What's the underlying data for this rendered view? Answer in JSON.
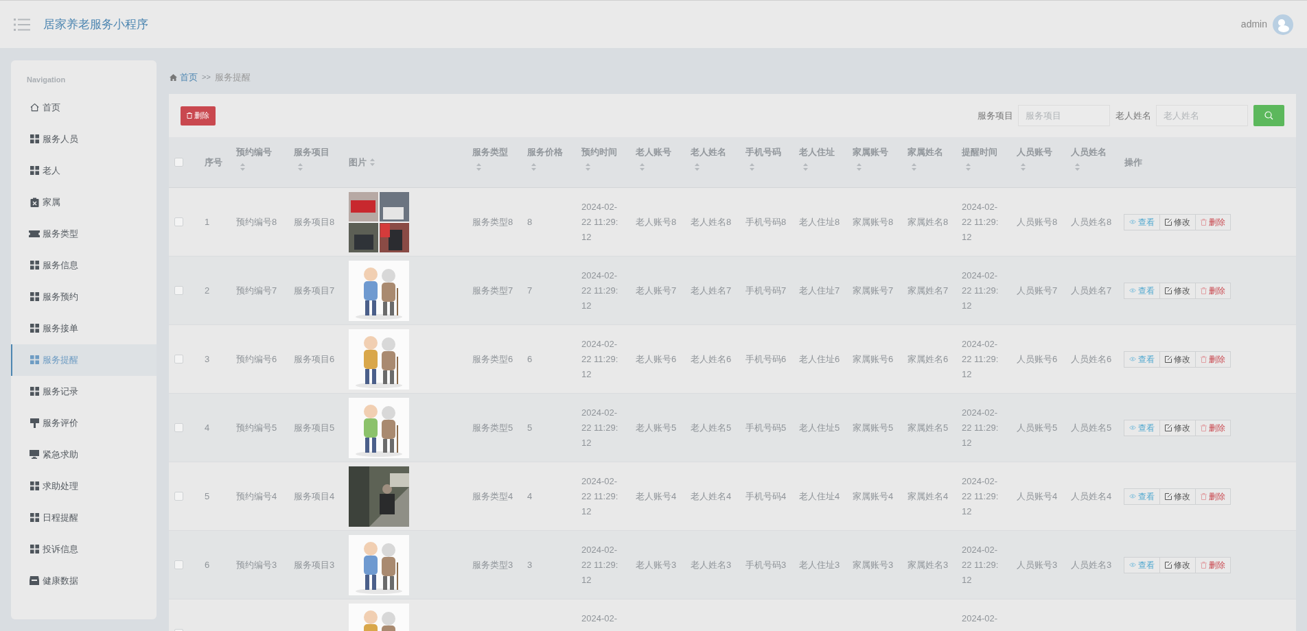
{
  "header": {
    "app_title": "居家养老服务小程序",
    "user": "admin"
  },
  "sidebar": {
    "heading": "Navigation",
    "items": [
      {
        "label": "首页",
        "selected": false
      },
      {
        "label": "服务人员",
        "selected": false
      },
      {
        "label": "老人",
        "selected": false
      },
      {
        "label": "家属",
        "selected": false
      },
      {
        "label": "服务类型",
        "selected": false
      },
      {
        "label": "服务信息",
        "selected": false
      },
      {
        "label": "服务预约",
        "selected": false
      },
      {
        "label": "服务接单",
        "selected": false
      },
      {
        "label": "服务提醒",
        "selected": true
      },
      {
        "label": "服务记录",
        "selected": false
      },
      {
        "label": "服务评价",
        "selected": false
      },
      {
        "label": "紧急求助",
        "selected": false
      },
      {
        "label": "求助处理",
        "selected": false
      },
      {
        "label": "日程提醒",
        "selected": false
      },
      {
        "label": "投诉信息",
        "selected": false
      },
      {
        "label": "健康数据",
        "selected": false
      }
    ]
  },
  "breadcrumb": {
    "home": "首页",
    "separator": ">>",
    "current": "服务提醒"
  },
  "toolbar": {
    "delete_button": "删除",
    "filters": [
      {
        "label": "服务项目",
        "placeholder": "服务项目"
      },
      {
        "label": "老人姓名",
        "placeholder": "老人姓名"
      }
    ]
  },
  "table": {
    "select_all_checked": false,
    "columns": [
      {
        "label": "序号",
        "kind": "plain"
      },
      {
        "label": "预约编号",
        "kind": "sortable"
      },
      {
        "label": "服务项目",
        "kind": "sortable"
      },
      {
        "label": "图片",
        "kind": "sortable-inline"
      },
      {
        "label": "服务类型",
        "kind": "sortable"
      },
      {
        "label": "服务价格",
        "kind": "sortable"
      },
      {
        "label": "预约时间",
        "kind": "sortable"
      },
      {
        "label": "老人账号",
        "kind": "sortable"
      },
      {
        "label": "老人姓名",
        "kind": "sortable"
      },
      {
        "label": "手机号码",
        "kind": "sortable"
      },
      {
        "label": "老人住址",
        "kind": "sortable"
      },
      {
        "label": "家属账号",
        "kind": "sortable"
      },
      {
        "label": "家属姓名",
        "kind": "sortable"
      },
      {
        "label": "提醒时间",
        "kind": "sortable"
      },
      {
        "label": "人员账号",
        "kind": "sortable"
      },
      {
        "label": "人员姓名",
        "kind": "sortable"
      },
      {
        "label": "操作",
        "kind": "plain"
      }
    ],
    "rows": [
      {
        "checked": false,
        "cells": [
          "1",
          "预约编号8",
          "服务项目8",
          {
            "kind": "picture"
          },
          "服务类型8",
          "8",
          "2024-02-22 11:29:12",
          "老人账号8",
          "老人姓名8",
          "手机号码8",
          "老人住址8",
          "家属账号8",
          "家属姓名8",
          "2024-02-22 11:29:12",
          "人员账号8",
          "人员姓名8",
          [
            "查看",
            "修改",
            "删除"
          ]
        ]
      },
      {
        "checked": false,
        "cells": [
          "2",
          "预约编号7",
          "服务项目7",
          {
            "kind": "picture"
          },
          "服务类型7",
          "7",
          "2024-02-22 11:29:12",
          "老人账号7",
          "老人姓名7",
          "手机号码7",
          "老人住址7",
          "家属账号7",
          "家属姓名7",
          "2024-02-22 11:29:12",
          "人员账号7",
          "人员姓名7",
          [
            "查看",
            "修改",
            "删除"
          ]
        ]
      },
      {
        "checked": false,
        "cells": [
          "3",
          "预约编号6",
          "服务项目6",
          {
            "kind": "picture"
          },
          "服务类型6",
          "6",
          "2024-02-22 11:29:12",
          "老人账号6",
          "老人姓名6",
          "手机号码6",
          "老人住址6",
          "家属账号6",
          "家属姓名6",
          "2024-02-22 11:29:12",
          "人员账号6",
          "人员姓名6",
          [
            "查看",
            "修改",
            "删除"
          ]
        ]
      },
      {
        "checked": false,
        "cells": [
          "4",
          "预约编号5",
          "服务项目5",
          {
            "kind": "picture"
          },
          "服务类型5",
          "5",
          "2024-02-22 11:29:12",
          "老人账号5",
          "老人姓名5",
          "手机号码5",
          "老人住址5",
          "家属账号5",
          "家属姓名5",
          "2024-02-22 11:29:12",
          "人员账号5",
          "人员姓名5",
          [
            "查看",
            "修改",
            "删除"
          ]
        ]
      },
      {
        "checked": false,
        "cells": [
          "5",
          "预约编号4",
          "服务项目4",
          {
            "kind": "picture"
          },
          "服务类型4",
          "4",
          "2024-02-22 11:29:12",
          "老人账号4",
          "老人姓名4",
          "手机号码4",
          "老人住址4",
          "家属账号4",
          "家属姓名4",
          "2024-02-22 11:29:12",
          "人员账号4",
          "人员姓名4",
          [
            "查看",
            "修改",
            "删除"
          ]
        ]
      },
      {
        "checked": false,
        "cells": [
          "6",
          "预约编号3",
          "服务项目3",
          {
            "kind": "picture"
          },
          "服务类型3",
          "3",
          "2024-02-22 11:29:12",
          "老人账号3",
          "老人姓名3",
          "手机号码3",
          "老人住址3",
          "家属账号3",
          "家属姓名3",
          "2024-02-22 11:29:12",
          "人员账号3",
          "人员姓名3",
          [
            "查看",
            "修改",
            "删除"
          ]
        ]
      },
      {
        "checked": false,
        "cells": [
          "",
          "",
          "",
          {
            "kind": "picture"
          },
          "",
          "",
          "2024-02-",
          "",
          "",
          "",
          "",
          "",
          "",
          "2024-02-",
          "",
          "",
          []
        ]
      }
    ]
  }
}
